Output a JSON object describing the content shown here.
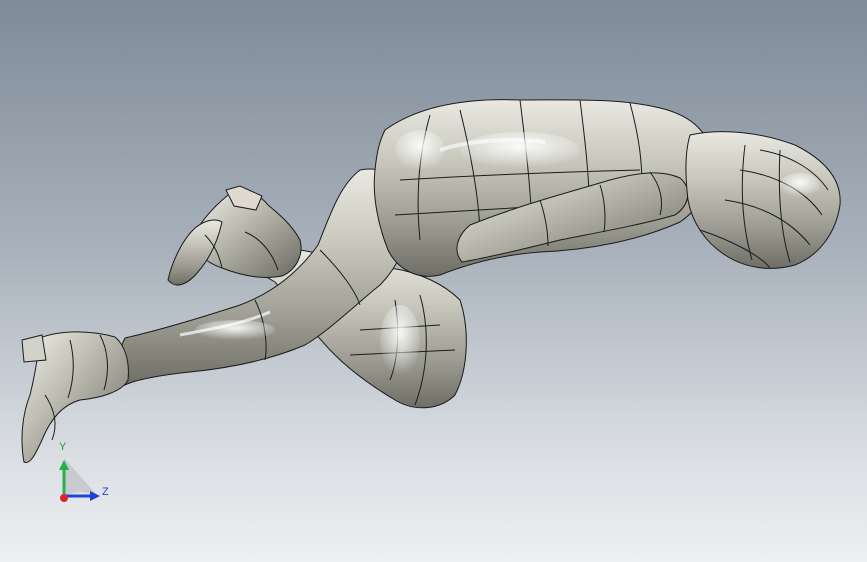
{
  "view": {
    "model_name": "",
    "colors": {
      "background_top": "#7f8b98",
      "background_bottom": "#eef0f2",
      "model_base": "#b9b9ae",
      "model_highlight": "#f6f6f0",
      "model_shadow": "#5f5f58",
      "edge_lines": "#1b1b1b"
    }
  },
  "triad": {
    "y_label": "Y",
    "z_label": "Z",
    "y_color": "#22b14c",
    "z_color": "#1f3fe0",
    "x_color": "#e0202a",
    "y_label_color": "#1f9c2e",
    "z_label_color": "#1f3fe0"
  }
}
